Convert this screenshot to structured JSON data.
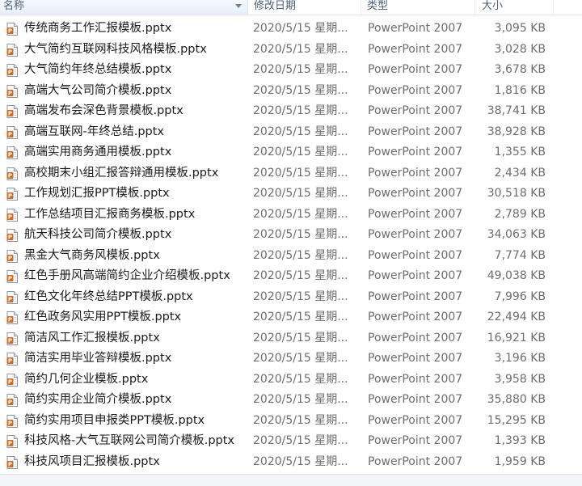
{
  "columns": {
    "name": "名称",
    "date": "修改日期",
    "type": "类型",
    "size": "大小"
  },
  "icons": {
    "file": "powerpoint-file-icon",
    "sort": "sort-down-arrow-icon"
  },
  "colors": {
    "header_text": "#4c607a",
    "meta_text": "#6d6d6d",
    "ppt_orange": "#d2691e"
  },
  "files": [
    {
      "name": "传统商务工作汇报模板.pptx",
      "date": "2020/5/15 星期...",
      "type": "PowerPoint 2007",
      "size": "3,095 KB"
    },
    {
      "name": "大气简约互联网科技风格模板.pptx",
      "date": "2020/5/15 星期...",
      "type": "PowerPoint 2007",
      "size": "3,028 KB"
    },
    {
      "name": "大气简约年终总结模板.pptx",
      "date": "2020/5/15 星期...",
      "type": "PowerPoint 2007",
      "size": "3,678 KB"
    },
    {
      "name": "高端大气公司简介模板.pptx",
      "date": "2020/5/15 星期...",
      "type": "PowerPoint 2007",
      "size": "1,816 KB"
    },
    {
      "name": "高端发布会深色背景模板.pptx",
      "date": "2020/5/15 星期...",
      "type": "PowerPoint 2007",
      "size": "38,741 KB"
    },
    {
      "name": "高端互联网-年终总结.pptx",
      "date": "2020/5/15 星期...",
      "type": "PowerPoint 2007",
      "size": "38,928 KB"
    },
    {
      "name": "高端实用商务通用模板.pptx",
      "date": "2020/5/15 星期...",
      "type": "PowerPoint 2007",
      "size": "1,355 KB"
    },
    {
      "name": "高校期末小组汇报答辩通用模板.pptx",
      "date": "2020/5/15 星期...",
      "type": "PowerPoint 2007",
      "size": "2,434 KB"
    },
    {
      "name": "工作规划汇报PPT模板.pptx",
      "date": "2020/5/15 星期...",
      "type": "PowerPoint 2007",
      "size": "30,518 KB"
    },
    {
      "name": "工作总结项目汇报商务模板.pptx",
      "date": "2020/5/15 星期...",
      "type": "PowerPoint 2007",
      "size": "2,789 KB"
    },
    {
      "name": "航天科技公司简介模板.pptx",
      "date": "2020/5/15 星期...",
      "type": "PowerPoint 2007",
      "size": "34,063 KB"
    },
    {
      "name": "黑金大气商务风模板.pptx",
      "date": "2020/5/15 星期...",
      "type": "PowerPoint 2007",
      "size": "7,774 KB"
    },
    {
      "name": "红色手册风高端简约企业介绍模板.pptx",
      "date": "2020/5/15 星期...",
      "type": "PowerPoint 2007",
      "size": "49,038 KB"
    },
    {
      "name": "红色文化年终总结PPT模板.pptx",
      "date": "2020/5/15 星期...",
      "type": "PowerPoint 2007",
      "size": "7,996 KB"
    },
    {
      "name": "红色政务风实用PPT模板.pptx",
      "date": "2020/5/15 星期...",
      "type": "PowerPoint 2007",
      "size": "22,494 KB"
    },
    {
      "name": "简洁风工作汇报模板.pptx",
      "date": "2020/5/15 星期...",
      "type": "PowerPoint 2007",
      "size": "16,921 KB"
    },
    {
      "name": "简洁实用毕业答辩模板.pptx",
      "date": "2020/5/15 星期...",
      "type": "PowerPoint 2007",
      "size": "3,196 KB"
    },
    {
      "name": "简约几何企业模板.pptx",
      "date": "2020/5/15 星期...",
      "type": "PowerPoint 2007",
      "size": "3,958 KB"
    },
    {
      "name": "简约实用企业简介模板.pptx",
      "date": "2020/5/15 星期...",
      "type": "PowerPoint 2007",
      "size": "35,880 KB"
    },
    {
      "name": "简约实用项目申报类PPT模板.pptx",
      "date": "2020/5/15 星期...",
      "type": "PowerPoint 2007",
      "size": "15,295 KB"
    },
    {
      "name": "科技风格-大气互联网公司简介模板.pptx",
      "date": "2020/5/15 星期...",
      "type": "PowerPoint 2007",
      "size": "1,393 KB"
    },
    {
      "name": "科技风项目汇报模板.pptx",
      "date": "2020/5/15 星期...",
      "type": "PowerPoint 2007",
      "size": "1,959 KB"
    }
  ]
}
